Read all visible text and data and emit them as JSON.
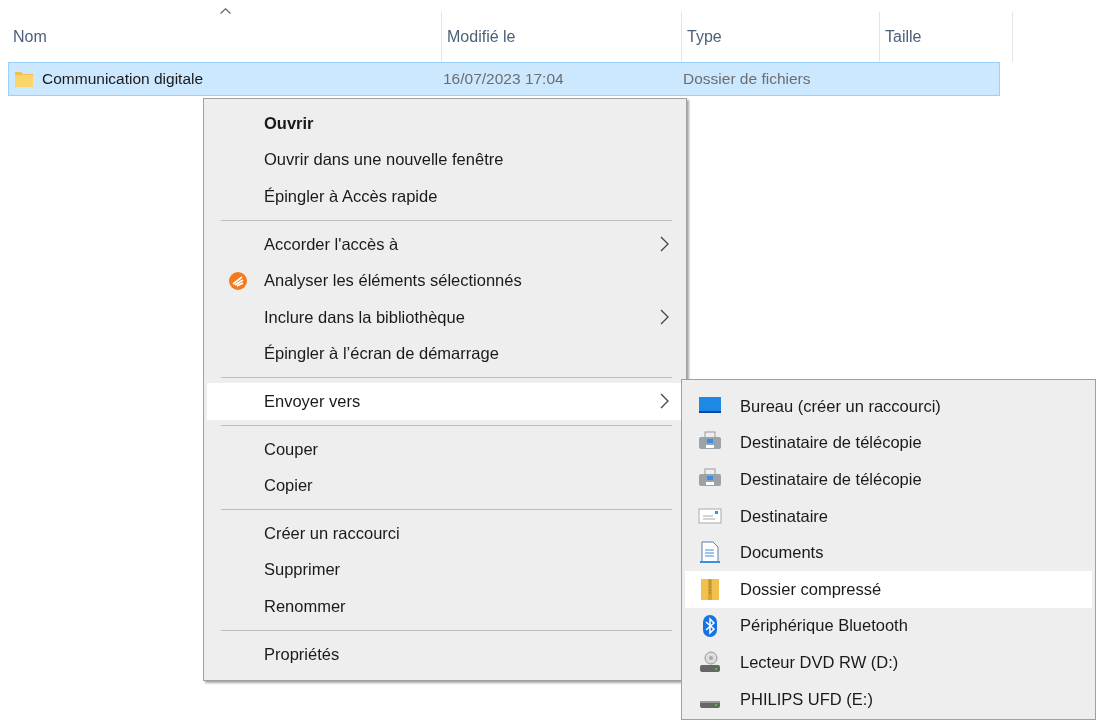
{
  "columns": [
    {
      "label": "Nom",
      "sorted": true
    },
    {
      "label": "Modifié le",
      "sorted": false
    },
    {
      "label": "Type",
      "sorted": false
    },
    {
      "label": "Taille",
      "sorted": false
    }
  ],
  "rows": [
    {
      "name": "Communication digitale",
      "modified": "16/07/2023 17:04",
      "type": "Dossier de fichiers",
      "selected": true
    }
  ],
  "context_menu": {
    "groups": [
      [
        {
          "label": "Ouvrir",
          "kind": "default",
          "selected": false
        },
        {
          "label": "Ouvrir dans une nouvelle fenêtre",
          "kind": "plain",
          "selected": false
        },
        {
          "label": "Épingler à Accès rapide",
          "kind": "plain",
          "selected": false
        }
      ],
      [
        {
          "label": "Accorder l'accès à",
          "kind": "submenu",
          "selected": false
        },
        {
          "label": "Analyser les éléments sélectionnés",
          "kind": "antivirus",
          "selected": false
        },
        {
          "label": "Inclure dans la bibliothèque",
          "kind": "submenu",
          "selected": false
        },
        {
          "label": "Épingler à l’écran de démarrage",
          "kind": "plain",
          "selected": false
        }
      ],
      [
        {
          "label": "Envoyer vers",
          "kind": "submenu",
          "selected": true
        }
      ],
      [
        {
          "label": "Couper",
          "kind": "plain",
          "selected": false
        },
        {
          "label": "Copier",
          "kind": "plain",
          "selected": false
        }
      ],
      [
        {
          "label": "Créer un raccourci",
          "kind": "plain",
          "selected": false
        },
        {
          "label": "Supprimer",
          "kind": "plain",
          "selected": false
        },
        {
          "label": "Renommer",
          "kind": "plain",
          "selected": false
        }
      ],
      [
        {
          "label": "Propriétés",
          "kind": "plain",
          "selected": false
        }
      ]
    ]
  },
  "send_to_menu": {
    "items": [
      {
        "label": "Bureau (créer un raccourci)",
        "kind": "desktop",
        "selected": false
      },
      {
        "label": "Destinataire de télécopie",
        "kind": "fax",
        "selected": false
      },
      {
        "label": "Destinataire de télécopie",
        "kind": "fax",
        "selected": false
      },
      {
        "label": "Destinataire",
        "kind": "mail",
        "selected": false
      },
      {
        "label": "Documents",
        "kind": "documents",
        "selected": false
      },
      {
        "label": "Dossier compressé",
        "kind": "zip",
        "selected": true
      },
      {
        "label": "Périphérique Bluetooth",
        "kind": "bluetooth",
        "selected": false
      },
      {
        "label": "Lecteur DVD RW (D:)",
        "kind": "dvd",
        "selected": false
      },
      {
        "label": "PHILIPS UFD (E:)",
        "kind": "usb",
        "selected": false
      }
    ]
  }
}
